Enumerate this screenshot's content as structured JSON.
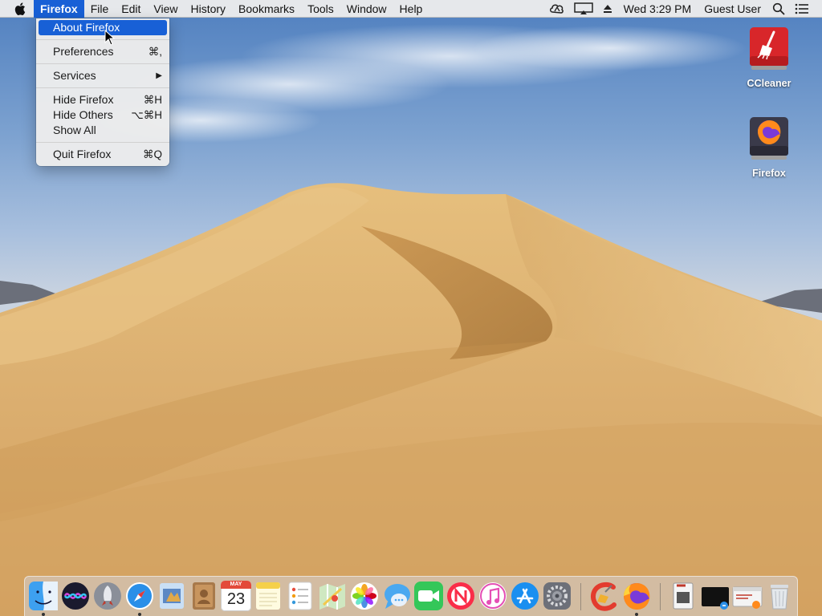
{
  "menubar": {
    "app_name": "Firefox",
    "menus": [
      "File",
      "Edit",
      "View",
      "History",
      "Bookmarks",
      "Tools",
      "Window",
      "Help"
    ],
    "clock": "Wed 3:29 PM",
    "user": "Guest User",
    "status_icons": [
      "creative-cloud-icon",
      "airplay-display-icon",
      "eject-icon",
      "spotlight-search-icon",
      "notification-center-icon"
    ]
  },
  "app_menu": {
    "about": "About Firefox",
    "preferences": "Preferences",
    "preferences_shortcut": "⌘,",
    "services": "Services",
    "services_arrow": "▶",
    "hide": "Hide Firefox",
    "hide_shortcut": "⌘H",
    "hide_others": "Hide Others",
    "hide_others_shortcut": "⌥⌘H",
    "show_all": "Show All",
    "quit": "Quit Firefox",
    "quit_shortcut": "⌘Q"
  },
  "desktop_icons": [
    "CCleaner",
    "Firefox"
  ],
  "dock": {
    "calendar_month": "MAY",
    "calendar_day": "23",
    "apps": [
      "Finder",
      "Siri",
      "Launchpad",
      "Safari",
      "Mail",
      "Contacts",
      "Calendar",
      "Notes",
      "Reminders",
      "Maps",
      "Photos",
      "Messages",
      "FaceTime",
      "News",
      "iTunes",
      "App Store",
      "System Preferences",
      "CCleaner",
      "Firefox",
      "Preview",
      "Terminal",
      "Firefox Downloads",
      "Trash"
    ]
  },
  "colors": {
    "selection": "#1860d6",
    "sky_top": "#4f7fbf",
    "sand": "#d9a862"
  }
}
